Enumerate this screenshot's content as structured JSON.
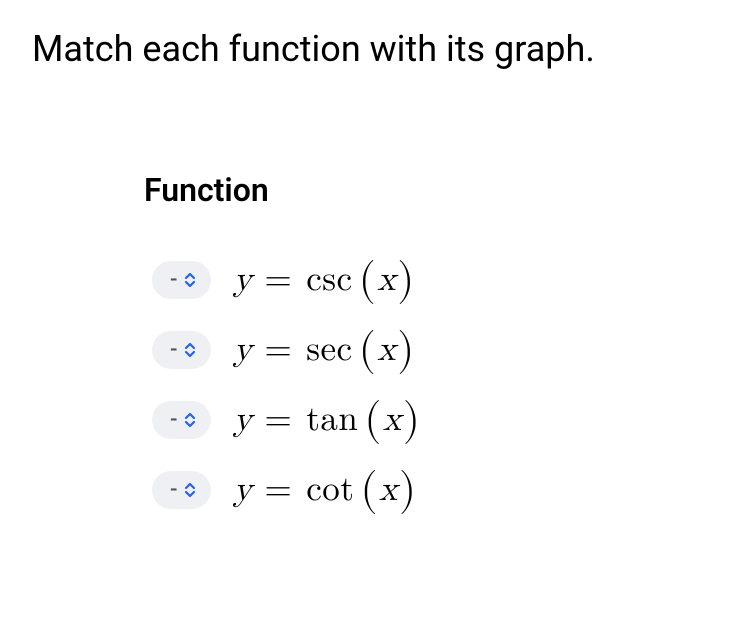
{
  "prompt": "Match each function with its graph.",
  "section_title": "Function",
  "selector_placeholder": "-",
  "items": [
    {
      "func": "csc",
      "yvar": "y",
      "eq": "=",
      "xvar": "x"
    },
    {
      "func": "sec",
      "yvar": "y",
      "eq": "=",
      "xvar": "x"
    },
    {
      "func": "tan",
      "yvar": "y",
      "eq": "=",
      "xvar": "x"
    },
    {
      "func": "cot",
      "yvar": "y",
      "eq": "=",
      "xvar": "x"
    }
  ]
}
